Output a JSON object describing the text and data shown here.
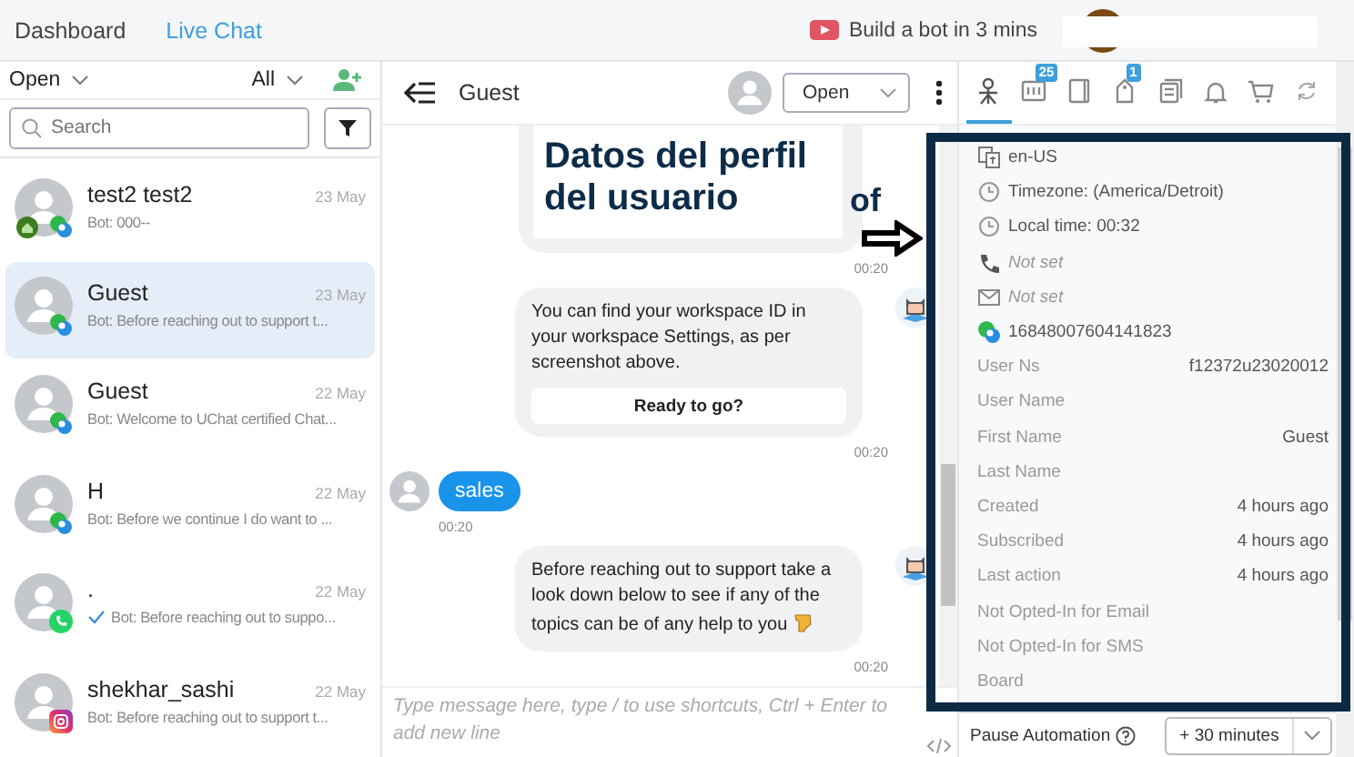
{
  "topbar": {
    "tabs": [
      {
        "label": "Dashboard",
        "selected": false
      },
      {
        "label": "Live Chat",
        "selected": true
      }
    ],
    "promo": "Build a bot in 3 mins"
  },
  "inbox": {
    "status_filter": "Open",
    "assignee_filter": "All",
    "search": {
      "placeholder": "Search"
    },
    "conversations": [
      {
        "kind": "webchat",
        "name": "test2 test2",
        "date": "23 May",
        "preview": "Bot: 000--",
        "home_badge": true,
        "read_tick": false,
        "selected": false
      },
      {
        "kind": "webchat",
        "name": "Guest",
        "date": "23 May",
        "preview": "Bot: Before reaching out to support t...",
        "home_badge": false,
        "read_tick": false,
        "selected": true
      },
      {
        "kind": "webchat",
        "name": "Guest",
        "date": "22 May",
        "preview": "Bot: Welcome to UChat certified Chat...",
        "home_badge": false,
        "read_tick": false,
        "selected": false
      },
      {
        "kind": "webchat",
        "name": "H",
        "date": "22 May",
        "preview": "Bot: Before we continue I do want to ...",
        "home_badge": false,
        "read_tick": false,
        "selected": false
      },
      {
        "kind": "whatsapp",
        "name": ".",
        "date": "22 May",
        "preview": "Bot: Before reaching out to suppo...",
        "home_badge": false,
        "read_tick": true,
        "selected": false
      },
      {
        "kind": "instagram",
        "name": "shekhar_sashi",
        "date": "22 May",
        "preview": "Bot: Before reaching out to support t...",
        "home_badge": false,
        "read_tick": false,
        "selected": false
      }
    ]
  },
  "chat": {
    "title": "Guest",
    "status": "Open",
    "messages": [
      {
        "kind": "image",
        "caption": "Datos del perfil del usuario",
        "time": "00:20"
      },
      {
        "kind": "bot",
        "text": "You can find your workspace ID in your workspace Settings, as per screenshot above.",
        "button": "Ready to go?",
        "time": "00:20"
      },
      {
        "kind": "user",
        "text": "sales",
        "time": "00:20"
      },
      {
        "kind": "bot-pointing",
        "text": "Before reaching out to support take a look down below to see if any of the topics can be of any help to you",
        "time": "00:20"
      }
    ],
    "composer": {
      "placeholder": "Type message here, type / to use shortcuts, Ctrl + Enter to add new line"
    }
  },
  "annotation": {
    "text": "of"
  },
  "profile": {
    "tabs": [
      {
        "kind": "person",
        "selected": true
      },
      {
        "kind": "list",
        "badge": "25",
        "selected": false
      },
      {
        "kind": "book",
        "selected": false
      },
      {
        "kind": "tag",
        "badge": "1",
        "selected": false
      },
      {
        "kind": "notes",
        "selected": false
      },
      {
        "kind": "bell",
        "selected": false
      },
      {
        "kind": "cart",
        "selected": false
      },
      {
        "kind": "refresh",
        "selected": false
      }
    ],
    "rows": [
      {
        "kind": "language",
        "text": "en-US"
      },
      {
        "kind": "clock",
        "text": "Timezone: (America/Detroit)"
      },
      {
        "kind": "clock",
        "text": "Local time: 00:32"
      },
      {
        "kind": "phone",
        "text": "Not set"
      },
      {
        "kind": "mail",
        "text": "Not set"
      },
      {
        "kind": "webchat",
        "text": "16848007604141823"
      },
      {
        "kind": "field",
        "label": "User Ns",
        "value": "f12372u23020012"
      },
      {
        "kind": "field",
        "label": "User Name"
      },
      {
        "kind": "field",
        "label": "First Name",
        "value": "Guest"
      },
      {
        "kind": "field",
        "label": "Last Name"
      },
      {
        "kind": "field",
        "label": "Created",
        "value": "4 hours ago"
      },
      {
        "kind": "field",
        "label": "Subscribed",
        "value": "4 hours ago"
      },
      {
        "kind": "field",
        "label": "Last action",
        "value": "4 hours ago"
      },
      {
        "kind": "field",
        "label": "Not Opted-In for Email"
      },
      {
        "kind": "field",
        "label": "Not Opted-In for SMS"
      },
      {
        "kind": "field",
        "label": "Board"
      }
    ],
    "pause": {
      "label": "Pause Automation",
      "value": "+ 30 minutes"
    }
  }
}
